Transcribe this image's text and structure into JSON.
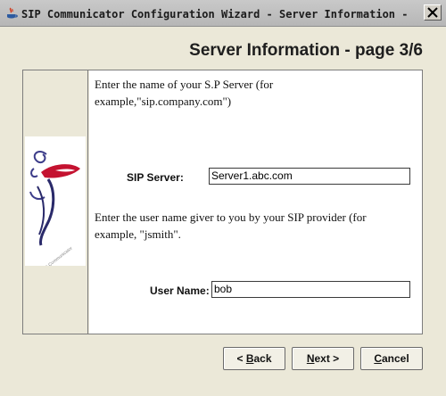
{
  "window": {
    "title": "SIP Communicator Configuration Wizard - Server Information - pa..."
  },
  "header": {
    "page_title": "Server Information - page 3/6"
  },
  "form": {
    "server_instruction": "Enter the name of your S.P Server (for example,\"sip.company.com\")",
    "server_label": "SIP Server:",
    "server_value": "Server1.abc.com",
    "user_instruction": "Enter the user name giver to you by your SIP provider (for example, \"jsmith\".",
    "user_label": "User Name:",
    "user_value": "bob"
  },
  "buttons": {
    "back": {
      "mnemonic": "B",
      "rest": "ack",
      "prefix": "< "
    },
    "next": {
      "mnemonic": "N",
      "rest": "ext >"
    },
    "cancel": {
      "mnemonic": "C",
      "rest": "ancel"
    }
  },
  "logo": {
    "text": "SIP Communicator"
  }
}
